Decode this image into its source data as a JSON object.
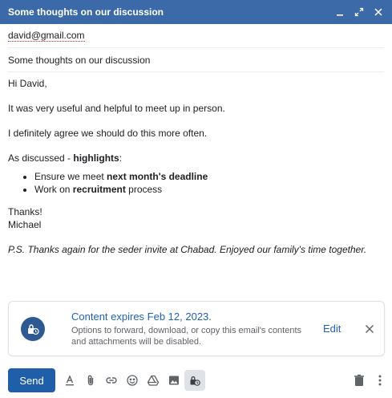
{
  "window": {
    "title": "Some thoughts on our discussion",
    "minimize_icon": "minimize-icon",
    "expand_icon": "expand-icon",
    "close_icon": "close-icon"
  },
  "compose": {
    "to": "david@gmail.com",
    "subject": "Some thoughts on our discussion"
  },
  "message": {
    "greeting": "Hi David,",
    "line1": "It was very useful and helpful to meet up in person.",
    "line2": "I definitely agree we should do this more often.",
    "discussed_prefix": "As discussed - ",
    "discussed_bold": "highlights",
    "discussed_suffix": ":",
    "bullets": [
      {
        "prefix": "Ensure we meet ",
        "bold": "next month's deadline",
        "suffix": ""
      },
      {
        "prefix": "Work on ",
        "bold": "recruitment",
        "suffix": " process"
      }
    ],
    "signoff": "Thanks!",
    "name": "Michael",
    "ps": "P.S. Thanks again for the seder invite at Chabad. Enjoyed our family's time together."
  },
  "banner": {
    "headline": "Content expires Feb 12, 2023.",
    "description": "Options to forward, download, or copy this email's contents and attachments will be disabled.",
    "edit_label": "Edit"
  },
  "toolbar": {
    "send_label": "Send"
  },
  "colors": {
    "titlebar": "#3c6aa8",
    "send": "#1f5fa9",
    "link": "#1f62b5",
    "badge": "#2d5a92"
  }
}
